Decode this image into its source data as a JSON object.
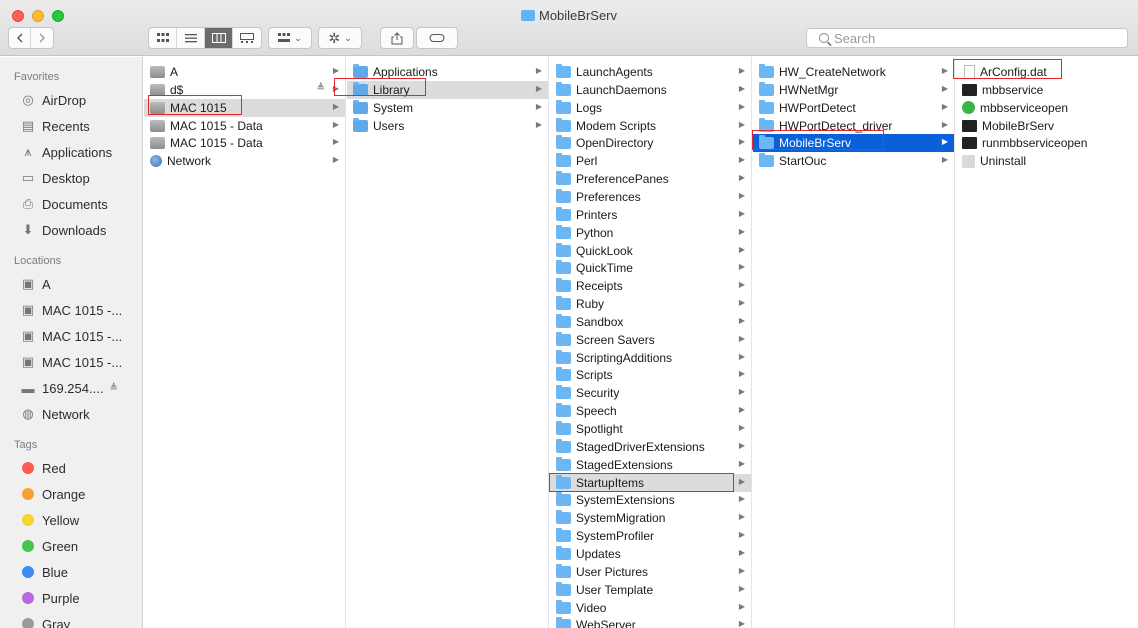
{
  "window": {
    "title": "MobileBrServ"
  },
  "toolbar": {
    "back_icon": "chevron-left-icon",
    "forward_icon": "chevron-right-icon",
    "search_placeholder": "Search"
  },
  "sidebar": {
    "favorites_header": "Favorites",
    "favorites": [
      {
        "label": "AirDrop",
        "icon": "airdrop-icon"
      },
      {
        "label": "Recents",
        "icon": "recents-icon"
      },
      {
        "label": "Applications",
        "icon": "applications-icon"
      },
      {
        "label": "Desktop",
        "icon": "desktop-icon"
      },
      {
        "label": "Documents",
        "icon": "documents-icon"
      },
      {
        "label": "Downloads",
        "icon": "downloads-icon"
      }
    ],
    "locations_header": "Locations",
    "locations": [
      {
        "label": "A",
        "icon": "disk-icon"
      },
      {
        "label": "MAC 1015 -...",
        "icon": "disk-icon"
      },
      {
        "label": "MAC 1015 -...",
        "icon": "disk-icon"
      },
      {
        "label": "MAC 1015 -...",
        "icon": "disk-icon"
      },
      {
        "label": "169.254....",
        "icon": "server-icon",
        "eject": "≜"
      },
      {
        "label": "Network",
        "icon": "network-icon"
      }
    ],
    "tags_header": "Tags",
    "tags": [
      {
        "label": "Red",
        "color": "#ff5a52"
      },
      {
        "label": "Orange",
        "color": "#f7a135"
      },
      {
        "label": "Yellow",
        "color": "#f7d42b"
      },
      {
        "label": "Green",
        "color": "#45c74f"
      },
      {
        "label": "Blue",
        "color": "#3a8df5"
      },
      {
        "label": "Purple",
        "color": "#b969db"
      },
      {
        "label": "Gray",
        "color": "#9a9a9a"
      }
    ]
  },
  "columns": {
    "col1": [
      {
        "label": "A",
        "icon": "disk"
      },
      {
        "label": "d$",
        "icon": "disk",
        "eject": "≜"
      },
      {
        "label": "MAC 1015",
        "icon": "disk",
        "selected": "gray"
      },
      {
        "label": "MAC 1015 - Data",
        "icon": "disk"
      },
      {
        "label": "MAC 1015 - Data",
        "icon": "disk"
      },
      {
        "label": "Network",
        "icon": "globe"
      }
    ],
    "col2": [
      {
        "label": "Applications",
        "icon": "folder"
      },
      {
        "label": "Library",
        "icon": "folder",
        "selected": "gray"
      },
      {
        "label": "System",
        "icon": "folder"
      },
      {
        "label": "Users",
        "icon": "folder"
      }
    ],
    "col3": [
      "LaunchAgents",
      "LaunchDaemons",
      "Logs",
      "Modem Scripts",
      "OpenDirectory",
      "Perl",
      "PreferencePanes",
      "Preferences",
      "Printers",
      "Python",
      "QuickLook",
      "QuickTime",
      "Receipts",
      "Ruby",
      "Sandbox",
      "Screen Savers",
      "ScriptingAdditions",
      "Scripts",
      "Security",
      "Speech",
      "Spotlight",
      "StagedDriverExtensions",
      "StagedExtensions",
      "StartupItems",
      "SystemExtensions",
      "SystemMigration",
      "SystemProfiler",
      "Updates",
      "User Pictures",
      "User Template",
      "Video",
      "WebServer"
    ],
    "col3_selected": "StartupItems",
    "col4": [
      "HW_CreateNetwork",
      "HWNetMgr",
      "HWPortDetect",
      "HWPortDetect_driver",
      "MobileBrServ",
      "StartOuc"
    ],
    "col4_selected": "MobileBrServ",
    "col5": [
      {
        "label": "ArConfig.dat",
        "icon": "doc"
      },
      {
        "label": "mbbservice",
        "icon": "term"
      },
      {
        "label": "mbbserviceopen",
        "icon": "green"
      },
      {
        "label": "MobileBrServ",
        "icon": "term"
      },
      {
        "label": "runmbbserviceopen",
        "icon": "term"
      },
      {
        "label": "Uninstall",
        "icon": "installer"
      }
    ]
  },
  "colors": {
    "selection_blue": "#0a60d9",
    "highlight_box": "#e0282e"
  }
}
